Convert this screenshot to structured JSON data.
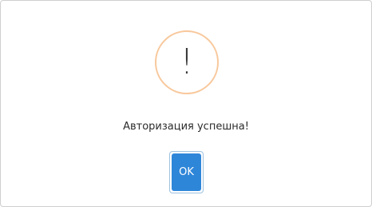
{
  "dialog": {
    "icon": "exclamation-icon",
    "icon_glyph": "!",
    "message": "Авторизация успешна!",
    "ok_label": "OK",
    "colors": {
      "icon_ring": "#f8c89c",
      "button": "#2e86d9",
      "button_text": "#ffffff",
      "text": "#2b2b2b"
    }
  }
}
